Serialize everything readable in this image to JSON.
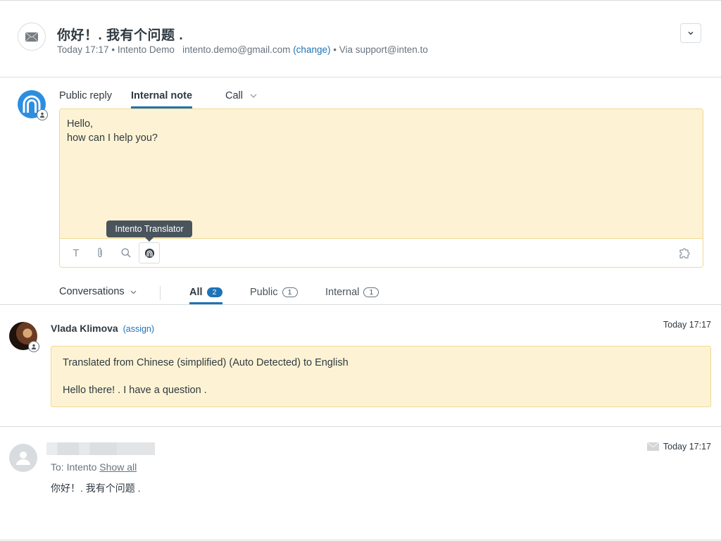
{
  "ticket": {
    "subject": "你好！. 我有个问题 .",
    "meta_time": "Today 17:17",
    "meta_sep": "•",
    "requester_name": "Intento Demo",
    "requester_email": "intento.demo@gmail.com",
    "change_label": "(change)",
    "via": "Via support@inten.to",
    "icon": "envelope-icon",
    "menu_icon": "chevron-down-icon"
  },
  "composer": {
    "tabs": [
      {
        "label": "Public reply",
        "active": false
      },
      {
        "label": "Internal note",
        "active": true
      },
      {
        "label": "Call",
        "active": false,
        "dropdown": true
      }
    ],
    "body_lines": [
      "Hello,",
      "how can I help you?"
    ],
    "toolbar": {
      "items": [
        {
          "icon": "text-format-icon",
          "glyph": "T"
        },
        {
          "icon": "paperclip-icon"
        },
        {
          "icon": "search-icon"
        },
        {
          "icon": "intento-translator-icon",
          "active": true
        }
      ],
      "right_icon": "puzzle-piece-icon",
      "tooltip": "Intento Translator"
    }
  },
  "filter_bar": {
    "dropdown_label": "Conversations",
    "tabs": [
      {
        "label": "All",
        "count": "2",
        "active": true
      },
      {
        "label": "Public",
        "count": "1",
        "active": false
      },
      {
        "label": "Internal",
        "count": "1",
        "active": false
      }
    ]
  },
  "messages": [
    {
      "author": "Vlada Klimova",
      "assign_label": "(assign)",
      "time": "Today 17:17",
      "note_header": "Translated from Chinese (simplified) (Auto Detected) to English",
      "note_text": "Hello there! . I have a question ."
    },
    {
      "author_redacted": true,
      "to_prefix": "To: Intento",
      "show_all_label": "Show all",
      "time": "Today 17:17",
      "body": "你好！. 我有个问题 ."
    }
  ],
  "colors": {
    "accent": "#1f73b7",
    "note_bg": "#fdf3d4",
    "note_border": "#f1d891",
    "text": "#2f3941",
    "muted": "#68737d"
  }
}
